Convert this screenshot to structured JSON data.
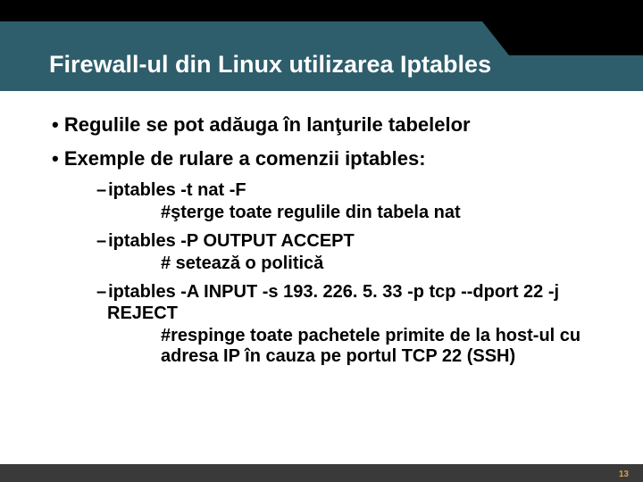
{
  "slide": {
    "title": "Firewall-ul din Linux utilizarea Iptables",
    "bullets_l1": [
      "Regulile se pot adăuga în lanţurile tabelelor",
      "Exemple de rulare a comenzii iptables:"
    ],
    "examples": [
      {
        "cmd": "iptables -t nat -F",
        "desc": "#şterge toate regulile din tabela nat"
      },
      {
        "cmd": "iptables -P OUTPUT ACCEPT",
        "desc": "# setează o politică"
      },
      {
        "cmd": "iptables -A INPUT -s 193. 226. 5. 33 -p tcp --dport 22 -j REJECT",
        "desc": "#respinge toate pachetele primite de la host-ul cu adresa IP în cauza pe portul TCP 22 (SSH)"
      }
    ],
    "page_number": "13"
  }
}
